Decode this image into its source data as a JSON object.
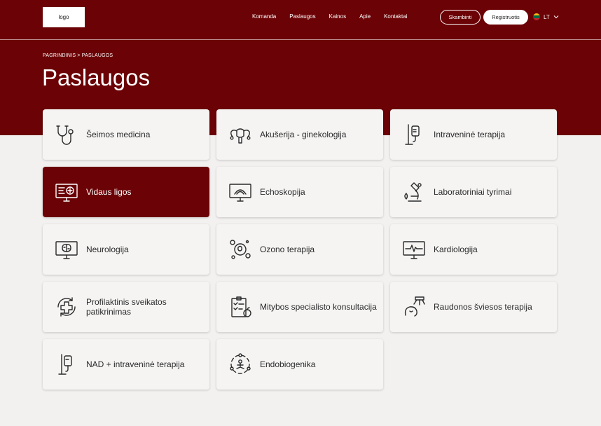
{
  "colors": {
    "brand": "#6b0205",
    "page_bg": "#f3f1f0",
    "card_bg": "#f5f4f3"
  },
  "header": {
    "logo": "logo",
    "nav": [
      "Komanda",
      "Paslaugos",
      "Kainos",
      "Apie",
      "Kontaktai"
    ],
    "call_label": "Skambinti",
    "register_label": "Registruotis",
    "lang": "LT"
  },
  "breadcrumb": "PAGRINDINIS > PASLAUGOS",
  "title": "Paslaugos",
  "services": [
    {
      "label": "Šeimos medicina",
      "icon": "stethoscope-icon"
    },
    {
      "label": "Akušerija - ginekologija",
      "icon": "uterus-icon"
    },
    {
      "label": "Intraveninė terapija",
      "icon": "iv-drip-icon"
    },
    {
      "label": "Vidaus ligos",
      "icon": "monitor-medical-icon",
      "active": true
    },
    {
      "label": "Echoskopija",
      "icon": "ultrasound-icon"
    },
    {
      "label": "Laboratoriniai tyrimai",
      "icon": "microscope-icon"
    },
    {
      "label": "Neurologija",
      "icon": "brain-monitor-icon"
    },
    {
      "label": "Ozono terapija",
      "icon": "ozone-icon"
    },
    {
      "label": "Kardiologija",
      "icon": "heartbeat-monitor-icon"
    },
    {
      "label": "Profilaktinis sveikatos patikrinimas",
      "icon": "health-check-icon"
    },
    {
      "label": "Mitybos specialisto konsultacija",
      "icon": "diet-plan-icon"
    },
    {
      "label": "Raudonos šviesos terapija",
      "icon": "red-light-icon"
    },
    {
      "label": "NAD + intraveninė terapija",
      "icon": "nad-drip-icon"
    },
    {
      "label": "Endobiogenika",
      "icon": "endobiogenics-icon"
    }
  ]
}
